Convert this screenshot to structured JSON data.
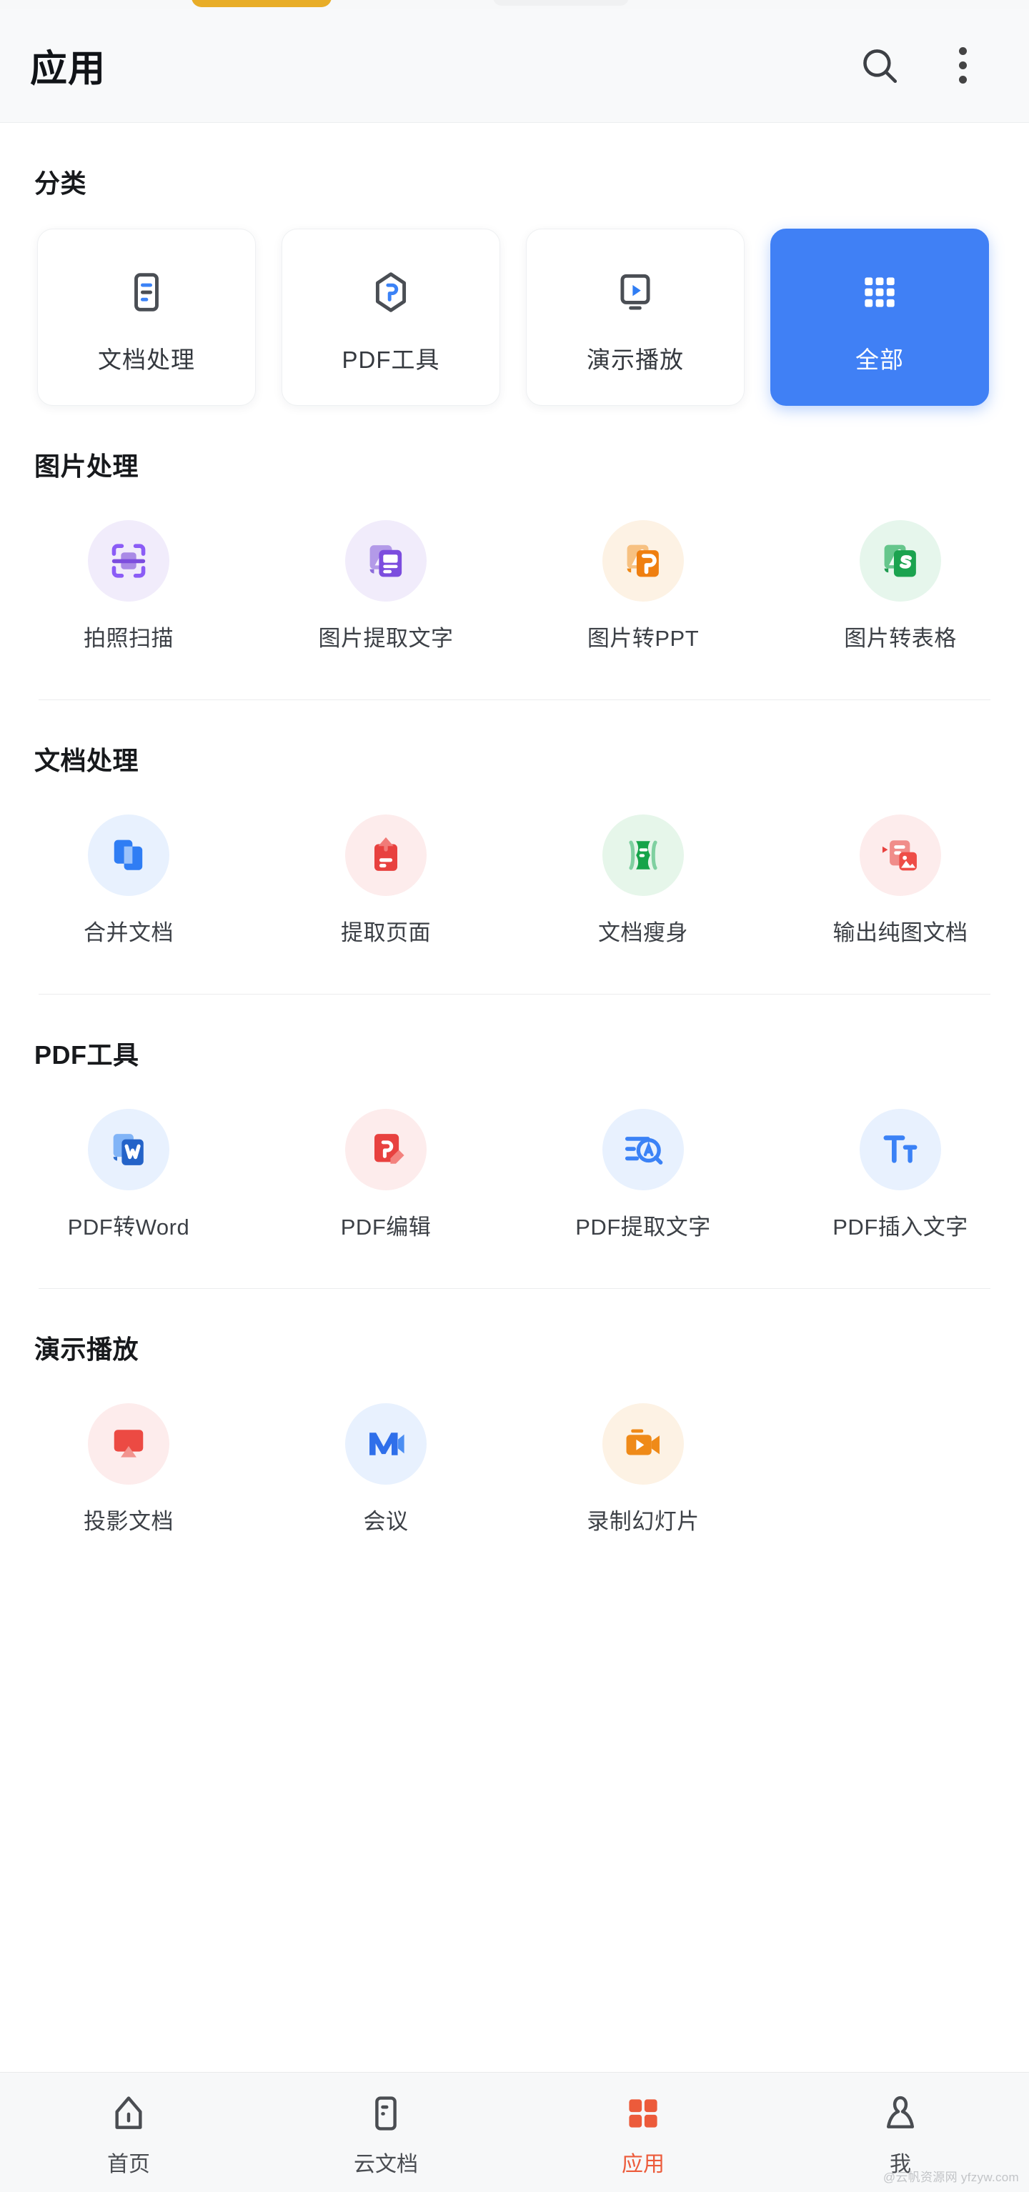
{
  "header": {
    "title": "应用",
    "search_icon": "search-icon",
    "more_icon": "more-vertical-icon"
  },
  "categories": {
    "section_title": "分类",
    "items": [
      {
        "label": "文档处理",
        "icon": "document-processing-icon",
        "active": false
      },
      {
        "label": "PDF工具",
        "icon": "pdf-tool-icon",
        "active": false
      },
      {
        "label": "演示播放",
        "icon": "presentation-play-icon",
        "active": false
      },
      {
        "label": "全部",
        "icon": "grid-all-icon",
        "active": true
      }
    ],
    "active_color": "#4080f5"
  },
  "sections": [
    {
      "title": "图片处理",
      "tools": [
        {
          "label": "拍照扫描",
          "icon": "scan-photo-icon",
          "bubble": "#f1ecfb",
          "color": "#8b5cf6"
        },
        {
          "label": "图片提取文字",
          "icon": "image-to-text-icon",
          "bubble": "#f1ecfb",
          "color": "#7c4dde"
        },
        {
          "label": "图片转PPT",
          "icon": "image-to-ppt-icon",
          "bubble": "#fdf2e4",
          "color": "#ef7f10"
        },
        {
          "label": "图片转表格",
          "icon": "image-to-table-icon",
          "bubble": "#e6f6ec",
          "color": "#21a council"
        }
      ]
    },
    {
      "title": "文档处理",
      "tools": [
        {
          "label": "合并文档",
          "icon": "merge-document-icon",
          "bubble": "#e8f1fe",
          "color": "#2f7df4"
        },
        {
          "label": "提取页面",
          "icon": "extract-page-icon",
          "bubble": "#fdecec",
          "color": "#e8413f"
        },
        {
          "label": "文档瘦身",
          "icon": "slim-document-icon",
          "bubble": "#e6f6ea",
          "color": "#16a44a"
        },
        {
          "label": "输出纯图文档",
          "icon": "image-only-doc-icon",
          "bubble": "#fdecec",
          "color": "#ef5a55"
        }
      ]
    },
    {
      "title": "PDF工具",
      "tools": [
        {
          "label": "PDF转Word",
          "icon": "pdf-to-word-icon",
          "bubble": "#e8f1fe",
          "color": "#2f6fd0"
        },
        {
          "label": "PDF编辑",
          "icon": "pdf-edit-icon",
          "bubble": "#fdecec",
          "color": "#e8413f"
        },
        {
          "label": "PDF提取文字",
          "icon": "pdf-extract-text-icon",
          "bubble": "#e8f1fe",
          "color": "#3b82f6"
        },
        {
          "label": "PDF插入文字",
          "icon": "pdf-insert-text-icon",
          "bubble": "#e8f1fe",
          "color": "#3b82f6"
        }
      ]
    },
    {
      "title": "演示播放",
      "tools": [
        {
          "label": "投影文档",
          "icon": "project-document-icon",
          "bubble": "#fdecec",
          "color": "#ec4a43"
        },
        {
          "label": "会议",
          "icon": "meeting-video-icon",
          "bubble": "#e8f1fe",
          "color": "#2f6fea"
        },
        {
          "label": "录制幻灯片",
          "icon": "record-slides-icon",
          "bubble": "#fdf2e4",
          "color": "#ef8a18"
        }
      ]
    }
  ],
  "bottom_nav": {
    "items": [
      {
        "label": "首页",
        "icon": "home-icon",
        "active": false
      },
      {
        "label": "云文档",
        "icon": "cloud-doc-icon",
        "active": false
      },
      {
        "label": "应用",
        "icon": "apps-grid-icon",
        "active": true
      },
      {
        "label": "我",
        "icon": "person-icon",
        "active": false
      }
    ],
    "active_color": "#ec5b3b"
  },
  "watermark": "@云帆资源网 yfzyw.com"
}
